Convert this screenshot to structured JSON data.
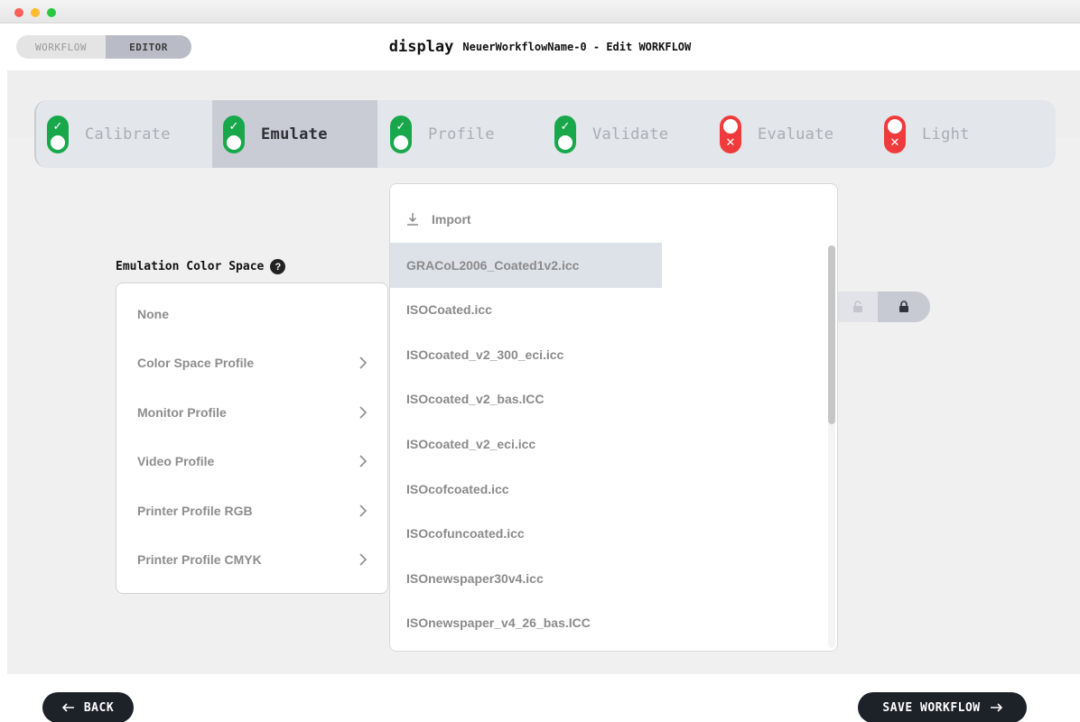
{
  "header": {
    "mode_toggle": {
      "workflow_label": "WORKFLOW",
      "editor_label": "EDITOR",
      "active": "editor"
    },
    "title_main": "display",
    "title_sub": "NeuerWorkflowName-0 - Edit WORKFLOW"
  },
  "steps": [
    {
      "label": "Calibrate",
      "status": "complete",
      "active": false
    },
    {
      "label": "Emulate",
      "status": "complete",
      "active": true
    },
    {
      "label": "Profile",
      "status": "complete",
      "active": false
    },
    {
      "label": "Validate",
      "status": "complete",
      "active": false
    },
    {
      "label": "Evaluate",
      "status": "incomplete",
      "active": false
    },
    {
      "label": "Light",
      "status": "incomplete",
      "active": false
    }
  ],
  "emulation": {
    "label": "Emulation Color Space",
    "help_icon": "question-circle-icon",
    "categories": [
      {
        "label": "None",
        "has_submenu": false
      },
      {
        "label": "Color Space Profile",
        "has_submenu": true
      },
      {
        "label": "Monitor Profile",
        "has_submenu": true
      },
      {
        "label": "Video Profile",
        "has_submenu": true
      },
      {
        "label": "Printer Profile RGB",
        "has_submenu": true
      },
      {
        "label": "Printer Profile CMYK",
        "has_submenu": true
      }
    ]
  },
  "profile_dropdown": {
    "import_label": "Import",
    "import_icon": "download-icon",
    "selected_index": 0,
    "items": [
      "GRACoL2006_Coated1v2.icc",
      "ISOCoated.icc",
      "ISOcoated_v2_300_eci.icc",
      "ISOcoated_v2_bas.ICC",
      "ISOcoated_v2_eci.icc",
      "ISOcofcoated.icc",
      "ISOcofuncoated.icc",
      "ISOnewspaper30v4.icc",
      "ISOnewspaper_v4_26_bas.ICC"
    ]
  },
  "lock_toggle": {
    "state": "locked",
    "icons": [
      "unlock-icon",
      "lock-icon"
    ]
  },
  "footer": {
    "back_label": "BACK",
    "save_label": "SAVE WORKFLOW"
  },
  "colors": {
    "complete": "#18a84b",
    "incomplete": "#ef3b3b",
    "dark_button": "#1d2128",
    "active_step": "#c9ccd4"
  }
}
